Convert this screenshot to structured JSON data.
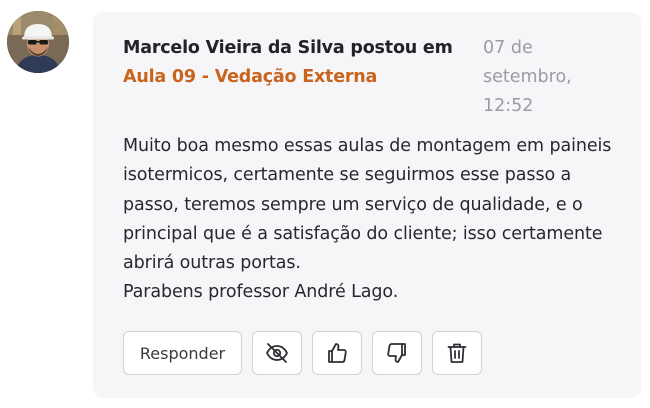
{
  "comment": {
    "author": "Marcelo Vieira da Silva",
    "verb": "postou em",
    "lesson": "Aula 09 - Vedação Externa",
    "date": "07 de setembro, 12:52",
    "body_lines": [
      "Muito boa mesmo essas aulas de montagem em paineis isotermicos, certamente se seguirmos esse passo a passo, teremos sempre um serviço de qualidade, e o principal que é a satisfação do cliente; isso certamente abrirá outras portas.",
      "Parabens professor André Lago."
    ]
  },
  "actions": {
    "reply_label": "Responder",
    "icons": [
      "eye-off-icon",
      "thumbs-up-icon",
      "thumbs-down-icon",
      "trash-icon"
    ]
  },
  "colors": {
    "accent": "#c8641d",
    "card_bg": "#f6f6f8",
    "date_text": "#9a9ca3"
  }
}
